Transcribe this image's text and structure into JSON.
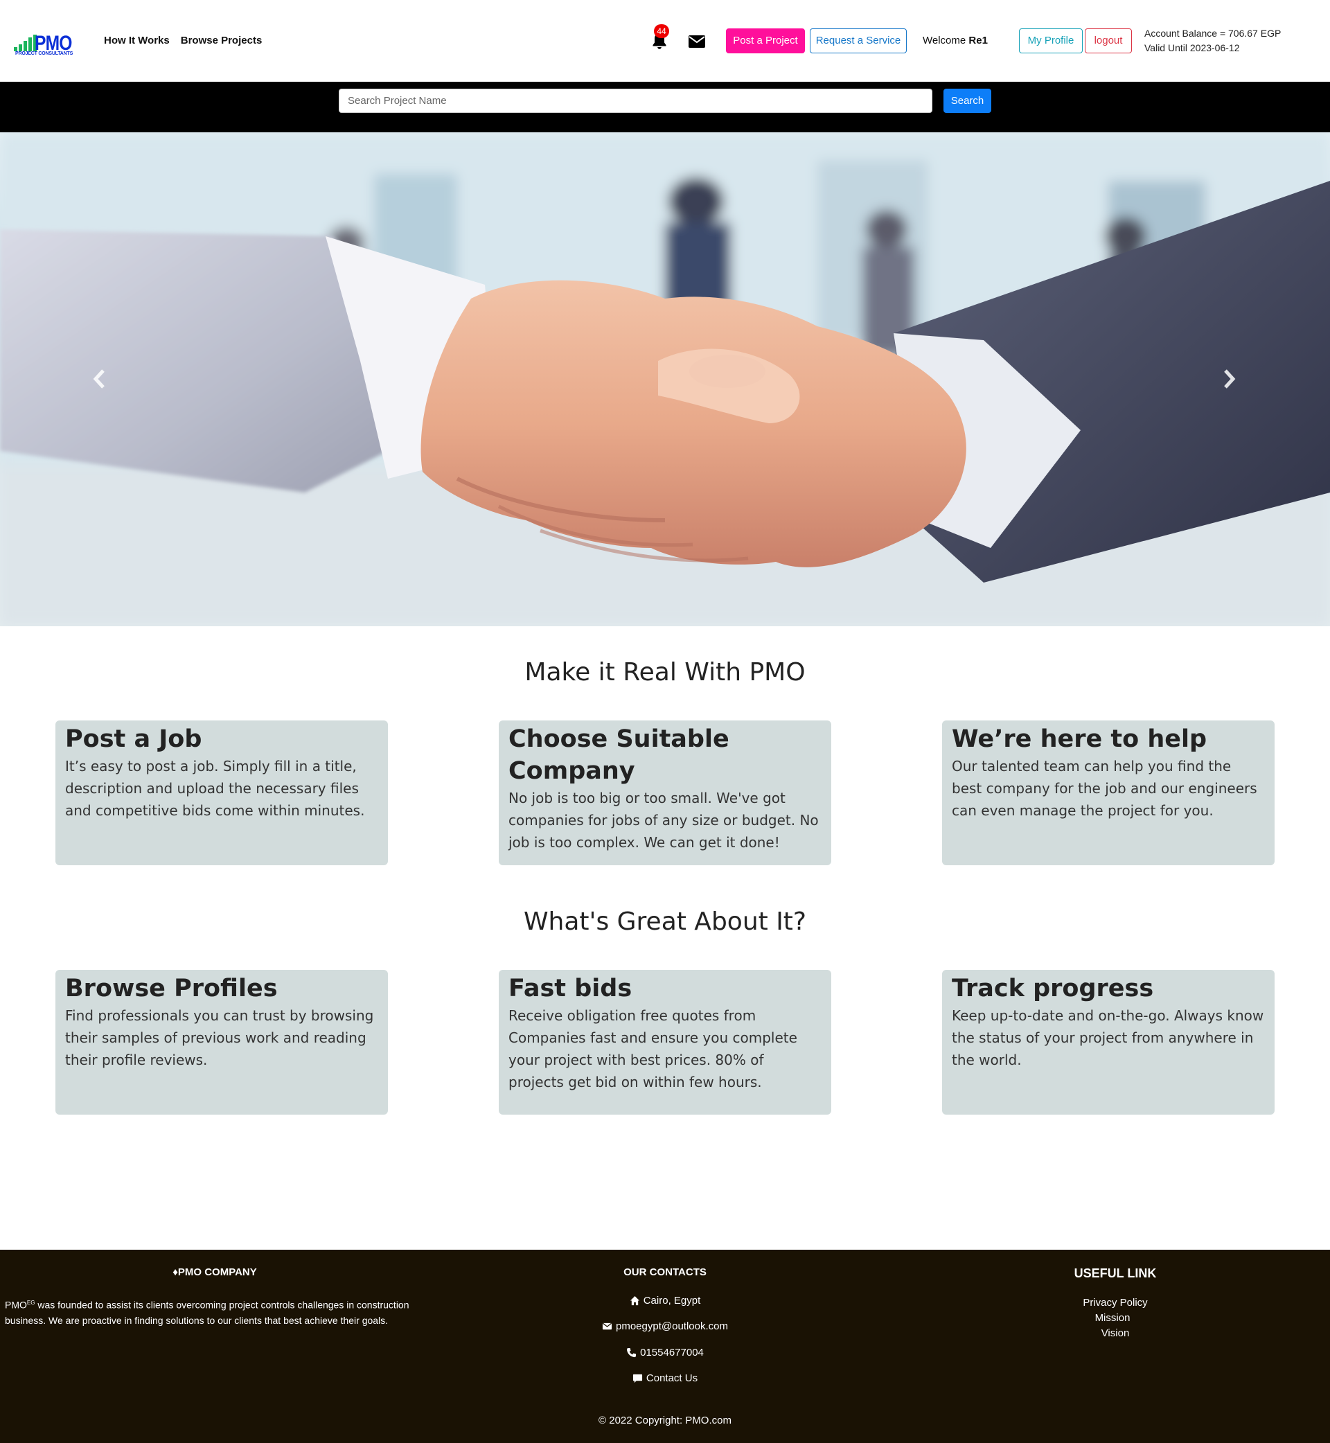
{
  "header": {
    "logo_text": "PMO",
    "logo_subtext": "PROJECT CONSULTANTS",
    "nav": [
      "How It Works",
      "Browse Projects"
    ],
    "notification_count": "44",
    "post_project_label": "Post a Project",
    "request_service_label": "Request a Service",
    "welcome_label": "Welcome",
    "username": "Re1",
    "my_profile_label": "My Profile",
    "logout_label": "logout",
    "account_balance": "Account Balance = 706.67 EGP",
    "valid_until": "Valid Until 2023-06-12"
  },
  "search": {
    "placeholder": "Search Project Name",
    "button_label": "Search"
  },
  "hero": {
    "image": "handshake-photo"
  },
  "section1": {
    "title": "Make it Real With PMO",
    "cards": [
      {
        "title": "Post a Job",
        "text": "It’s easy to post a job. Simply fill in a title, description and upload the necessary files and competitive bids come within minutes."
      },
      {
        "title": "Choose Suitable Company",
        "text": "No job is too big or too small. We've got companies for jobs of any size or budget. No job is too complex. We can get it done!"
      },
      {
        "title": "We’re here to help",
        "text": "Our talented team can help you find the best company for the job and our engineers can even manage the project for you."
      }
    ]
  },
  "section2": {
    "title": "What's Great About It?",
    "cards": [
      {
        "title": "Browse Profiles",
        "text": "Find professionals you can trust by browsing their samples of previous work and reading their profile reviews."
      },
      {
        "title": "Fast bids",
        "text": "Receive obligation free quotes from Companies fast and ensure you complete your project with best prices. 80% of projects get bid on within few hours."
      },
      {
        "title": "Track progress",
        "text": "Keep up-to-date and on-the-go. Always know the status of your project from anywhere in the world."
      }
    ]
  },
  "footer": {
    "company_title": "PMO COMPANY",
    "company_text_prefix": "PMO",
    "company_text_sup": "EG",
    "company_text": " was founded to assist its clients overcoming project controls challenges in construction business. We are proactive in finding solutions to our clients that best achieve their goals.",
    "contacts_title": "OUR CONTACTS",
    "address": "Cairo, Egypt",
    "email": "pmoegypt@outlook.com",
    "phone": "01554677004",
    "contact_us": "Contact Us",
    "useful_title": "USEFUL LINK",
    "links": [
      "Privacy Policy",
      "Mission",
      "Vision"
    ],
    "copyright": "© 2022 Copyright: PMO.com"
  },
  "colors": {
    "post_button": "#ff0f9b",
    "request_button": "#1778c9",
    "profile_button": "#17a2b8",
    "logout_button": "#dc3545",
    "search_button": "#0d7ef8",
    "card_bg": "#d2dcdc",
    "footer_bg": "#1a1204",
    "logo_blue": "#0b2fd6",
    "logo_green": "#1bb55c"
  }
}
